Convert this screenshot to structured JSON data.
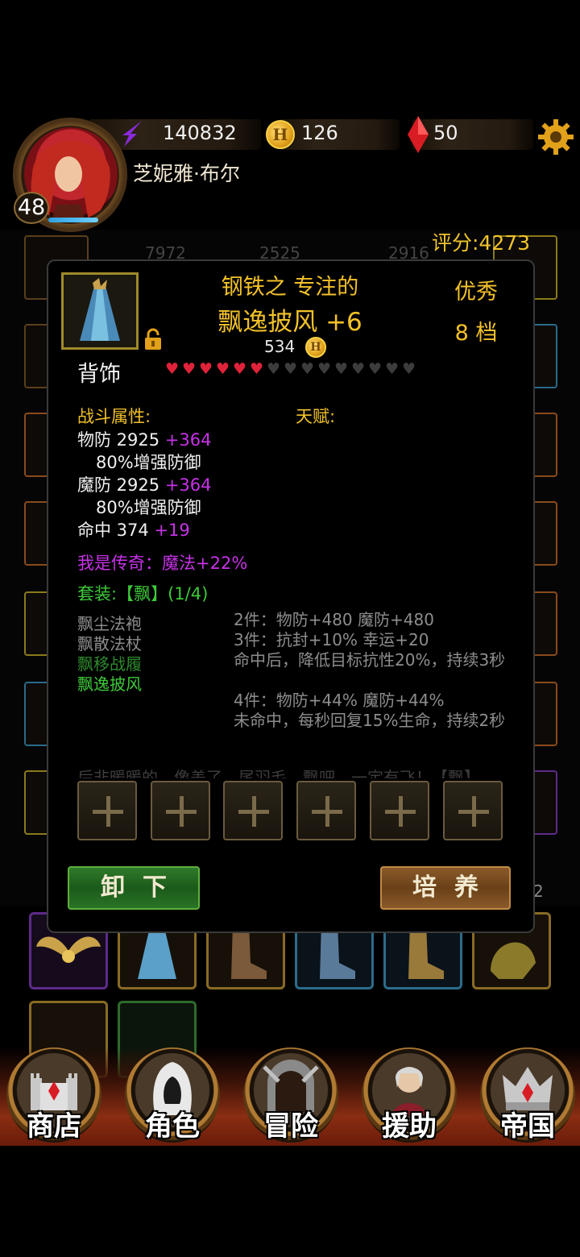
{
  "player": {
    "name": "芝妮雅·布尔",
    "level": "48",
    "power": "140832",
    "gold": "126",
    "gems": "50"
  },
  "background": {
    "score": "评分:4273",
    "stats": [
      "7972",
      "2525",
      "2916"
    ],
    "side_value": "2"
  },
  "item": {
    "prefix": "钢铁之 专注的",
    "name": "飘逸披风 +6",
    "quality": "优秀",
    "grade": "8 档",
    "price": "534",
    "slot": "背饰",
    "hearts_filled": 6,
    "hearts_total": 15,
    "combat_label": "战斗属性:",
    "talent_label": "天赋:",
    "stats": [
      {
        "name": "物防 2925",
        "bonus": "+364",
        "sub": "80%增强防御"
      },
      {
        "name": "魔防 2925",
        "bonus": "+364",
        "sub": "80%增强防御"
      },
      {
        "name": "命中 374",
        "bonus": "+19",
        "sub": ""
      }
    ],
    "legend": "我是传奇：魔法+22%",
    "set_title": "套装:【飘】(1/4)",
    "set_pieces": [
      {
        "name": "飘尘法袍",
        "owned": false
      },
      {
        "name": "飘散法杖",
        "owned": false
      },
      {
        "name": "飘移战履",
        "owned": "partial"
      },
      {
        "name": "飘逸披风",
        "owned": true
      }
    ],
    "set_bonuses": [
      "2件：物防+480 魔防+480",
      "3件：抗封+10% 幸运+20",
      "命中后，降低目标抗性20%，持续3秒",
      "4件：物防+44% 魔防+44%",
      "未命中，每秒回复15%生命，持续2秒"
    ],
    "flavor": "后非暖暖的，像盖了，尾羽毛，飘吧，一定有飞！【飘】"
  },
  "buttons": {
    "unequip": "卸下",
    "train": "培养"
  },
  "nav": [
    {
      "label": "商店"
    },
    {
      "label": "角色"
    },
    {
      "label": "冒险"
    },
    {
      "label": "援助"
    },
    {
      "label": "帝国"
    }
  ],
  "colors": {
    "gold_text": "#f3c229",
    "bonus_purple": "#c832e8",
    "set_green": "#3ec93a",
    "heart_red": "#e0233a"
  }
}
